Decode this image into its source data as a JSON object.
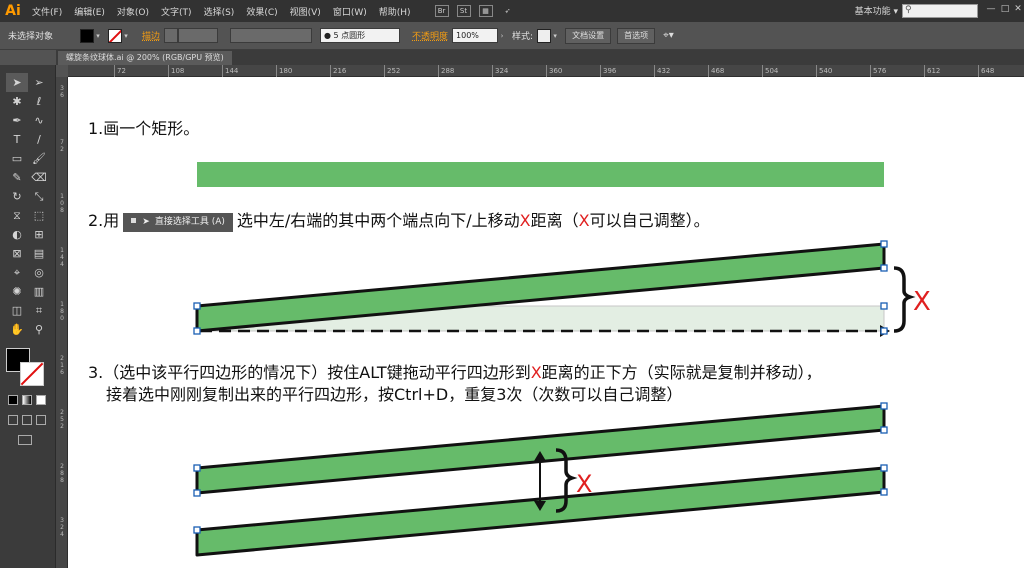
{
  "app": {
    "logo": "Ai"
  },
  "menu": [
    "文件(F)",
    "编辑(E)",
    "对象(O)",
    "文字(T)",
    "选择(S)",
    "效果(C)",
    "视图(V)",
    "窗口(W)",
    "帮助(H)"
  ],
  "menu_tools": {
    "br": "Br",
    "st": "St"
  },
  "workspace": "基本功能",
  "window_buttons": {
    "minimize": "—",
    "restore": "□",
    "close": "✕"
  },
  "control": {
    "selection_label": "未选择对象",
    "stroke_label": "描边",
    "brush_label": "5 点圆形",
    "opacity_label": "不透明度",
    "opacity_value": "100%",
    "style_label": "样式",
    "doc_setup": "文档设置",
    "preferences": "首选项"
  },
  "document_tab": "螺旋条纹球体.ai @ 200% (RGB/GPU 预览)",
  "ruler_h": [
    "72",
    "108",
    "144",
    "180",
    "216",
    "252",
    "288",
    "324",
    "360",
    "396",
    "432",
    "468",
    "504",
    "540",
    "576",
    "612",
    "648"
  ],
  "ruler_v": [
    "36",
    "72",
    "108",
    "144",
    "180",
    "216",
    "252",
    "288",
    "324"
  ],
  "tools": [
    "selection-icon",
    "direct-selection-icon",
    "magic-wand-icon",
    "lasso-icon",
    "pen-icon",
    "curvature-icon",
    "type-icon",
    "line-icon",
    "rectangle-icon",
    "paintbrush-icon",
    "pencil-icon",
    "eraser-icon",
    "rotate-icon",
    "scale-icon",
    "width-icon",
    "free-transform-icon",
    "shape-builder-icon",
    "perspective-icon",
    "mesh-icon",
    "gradient-icon",
    "eyedropper-icon",
    "blend-icon",
    "symbol-sprayer-icon",
    "column-graph-icon",
    "artboard-icon",
    "slice-icon",
    "hand-icon",
    "zoom-icon"
  ],
  "colors": {
    "shape_green": "#66bb6a",
    "accent_red": "#e02020",
    "ghost_fill": "#e3eee3"
  },
  "content": {
    "step1": "1.画一个矩形。",
    "step2_pre": "2.用",
    "step2_tool": "直接选择工具  (A)",
    "step2_mid": "选中左/右端的其中两个端点向下/上移动",
    "step2_x": "X",
    "step2_post": "距离（",
    "step2_x2": "X",
    "step2_end": "可以自己调整）。",
    "step3_line1_pre": "3.（选中该平行四边形的情况下）按住ALT键拖动平行四边形到",
    "step3_x": "X",
    "step3_line1_post": "距离的正下方（实际就是复制并移动），",
    "step3_line2": "接着选中刚刚复制出来的平行四边形，按Ctrl+D，重复3次（次数可以自己调整）",
    "x_label": "X"
  }
}
